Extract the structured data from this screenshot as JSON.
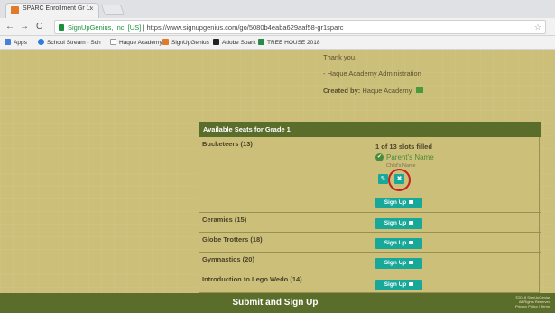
{
  "browser": {
    "tab_title": "SPARC Enrollment Gr 1:",
    "tab_close": "×",
    "url_secure": "SignUpGenius, Inc. [US]",
    "url_separator": "|",
    "url": "https://www.signupgenius.com/go/5080b4eaba629aaf58-gr1sparc",
    "back": "←",
    "forward": "→",
    "reload": "C",
    "star": "☆"
  },
  "bookmarks": [
    {
      "label": "Apps",
      "color": "#4a7fd8"
    },
    {
      "label": "School Stream - Sch",
      "color": "#2a7fd8"
    },
    {
      "label": "Haque Academy",
      "color": "#cccccc"
    },
    {
      "label": "SignUpGenius",
      "color": "#e07b2a"
    },
    {
      "label": "Adobe Spark",
      "color": "#222222"
    },
    {
      "label": "TREE HOUSE 2018",
      "color": "#2a8a4a"
    }
  ],
  "message": {
    "thanks": "Thank you.",
    "signature": "- Haque Academy Administration",
    "created_label": "Created by:",
    "created_by": "Haque Academy"
  },
  "panel": {
    "title": "Available Seats for Grade 1",
    "rows": [
      {
        "name": "Bucketeers (13)",
        "slots": "1 of 13 slots filled",
        "parent": "Parent's Name",
        "child": "Child's Name",
        "signup": "Sign Up"
      },
      {
        "name": "Ceramics (15)",
        "signup": "Sign Up"
      },
      {
        "name": "Globe Trotters (18)",
        "signup": "Sign Up"
      },
      {
        "name": "Gymnastics (20)",
        "signup": "Sign Up"
      },
      {
        "name": "Introduction to Lego Wedo (14)",
        "signup": "Sign Up"
      }
    ],
    "edit_icon": "✎",
    "delete_icon": "✖",
    "check_icon": "✔"
  },
  "footer": {
    "submit": "Submit and Sign Up",
    "credits": [
      "©2018 SignUpGenius",
      "All Rights Reserved",
      "Privacy Policy | Terms"
    ]
  },
  "colors": {
    "accent": "#18a89a",
    "header": "#5b6d2a",
    "page_bg": "#cbbf7a",
    "highlight": "#c42020"
  }
}
